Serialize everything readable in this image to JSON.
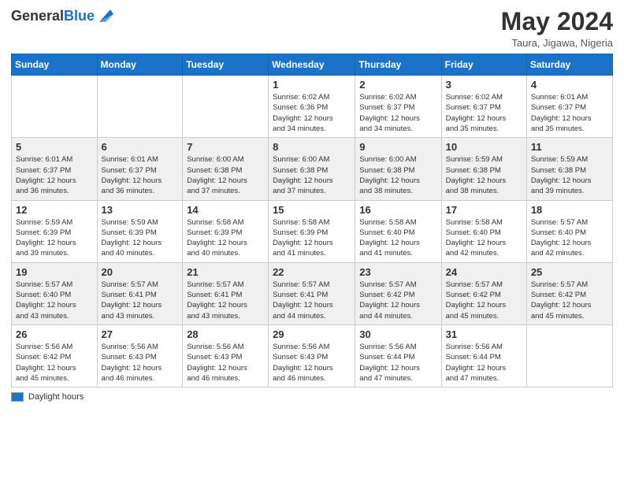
{
  "header": {
    "logo_general": "General",
    "logo_blue": "Blue",
    "month_title": "May 2024",
    "location": "Taura, Jigawa, Nigeria"
  },
  "days_of_week": [
    "Sunday",
    "Monday",
    "Tuesday",
    "Wednesday",
    "Thursday",
    "Friday",
    "Saturday"
  ],
  "weeks": [
    [
      {
        "day": "",
        "info": ""
      },
      {
        "day": "",
        "info": ""
      },
      {
        "day": "",
        "info": ""
      },
      {
        "day": "1",
        "info": "Sunrise: 6:02 AM\nSunset: 6:36 PM\nDaylight: 12 hours\nand 34 minutes."
      },
      {
        "day": "2",
        "info": "Sunrise: 6:02 AM\nSunset: 6:37 PM\nDaylight: 12 hours\nand 34 minutes."
      },
      {
        "day": "3",
        "info": "Sunrise: 6:02 AM\nSunset: 6:37 PM\nDaylight: 12 hours\nand 35 minutes."
      },
      {
        "day": "4",
        "info": "Sunrise: 6:01 AM\nSunset: 6:37 PM\nDaylight: 12 hours\nand 35 minutes."
      }
    ],
    [
      {
        "day": "5",
        "info": "Sunrise: 6:01 AM\nSunset: 6:37 PM\nDaylight: 12 hours\nand 36 minutes."
      },
      {
        "day": "6",
        "info": "Sunrise: 6:01 AM\nSunset: 6:37 PM\nDaylight: 12 hours\nand 36 minutes."
      },
      {
        "day": "7",
        "info": "Sunrise: 6:00 AM\nSunset: 6:38 PM\nDaylight: 12 hours\nand 37 minutes."
      },
      {
        "day": "8",
        "info": "Sunrise: 6:00 AM\nSunset: 6:38 PM\nDaylight: 12 hours\nand 37 minutes."
      },
      {
        "day": "9",
        "info": "Sunrise: 6:00 AM\nSunset: 6:38 PM\nDaylight: 12 hours\nand 38 minutes."
      },
      {
        "day": "10",
        "info": "Sunrise: 5:59 AM\nSunset: 6:38 PM\nDaylight: 12 hours\nand 38 minutes."
      },
      {
        "day": "11",
        "info": "Sunrise: 5:59 AM\nSunset: 6:38 PM\nDaylight: 12 hours\nand 39 minutes."
      }
    ],
    [
      {
        "day": "12",
        "info": "Sunrise: 5:59 AM\nSunset: 6:39 PM\nDaylight: 12 hours\nand 39 minutes."
      },
      {
        "day": "13",
        "info": "Sunrise: 5:59 AM\nSunset: 6:39 PM\nDaylight: 12 hours\nand 40 minutes."
      },
      {
        "day": "14",
        "info": "Sunrise: 5:58 AM\nSunset: 6:39 PM\nDaylight: 12 hours\nand 40 minutes."
      },
      {
        "day": "15",
        "info": "Sunrise: 5:58 AM\nSunset: 6:39 PM\nDaylight: 12 hours\nand 41 minutes."
      },
      {
        "day": "16",
        "info": "Sunrise: 5:58 AM\nSunset: 6:40 PM\nDaylight: 12 hours\nand 41 minutes."
      },
      {
        "day": "17",
        "info": "Sunrise: 5:58 AM\nSunset: 6:40 PM\nDaylight: 12 hours\nand 42 minutes."
      },
      {
        "day": "18",
        "info": "Sunrise: 5:57 AM\nSunset: 6:40 PM\nDaylight: 12 hours\nand 42 minutes."
      }
    ],
    [
      {
        "day": "19",
        "info": "Sunrise: 5:57 AM\nSunset: 6:40 PM\nDaylight: 12 hours\nand 43 minutes."
      },
      {
        "day": "20",
        "info": "Sunrise: 5:57 AM\nSunset: 6:41 PM\nDaylight: 12 hours\nand 43 minutes."
      },
      {
        "day": "21",
        "info": "Sunrise: 5:57 AM\nSunset: 6:41 PM\nDaylight: 12 hours\nand 43 minutes."
      },
      {
        "day": "22",
        "info": "Sunrise: 5:57 AM\nSunset: 6:41 PM\nDaylight: 12 hours\nand 44 minutes."
      },
      {
        "day": "23",
        "info": "Sunrise: 5:57 AM\nSunset: 6:42 PM\nDaylight: 12 hours\nand 44 minutes."
      },
      {
        "day": "24",
        "info": "Sunrise: 5:57 AM\nSunset: 6:42 PM\nDaylight: 12 hours\nand 45 minutes."
      },
      {
        "day": "25",
        "info": "Sunrise: 5:57 AM\nSunset: 6:42 PM\nDaylight: 12 hours\nand 45 minutes."
      }
    ],
    [
      {
        "day": "26",
        "info": "Sunrise: 5:56 AM\nSunset: 6:42 PM\nDaylight: 12 hours\nand 45 minutes."
      },
      {
        "day": "27",
        "info": "Sunrise: 5:56 AM\nSunset: 6:43 PM\nDaylight: 12 hours\nand 46 minutes."
      },
      {
        "day": "28",
        "info": "Sunrise: 5:56 AM\nSunset: 6:43 PM\nDaylight: 12 hours\nand 46 minutes."
      },
      {
        "day": "29",
        "info": "Sunrise: 5:56 AM\nSunset: 6:43 PM\nDaylight: 12 hours\nand 46 minutes."
      },
      {
        "day": "30",
        "info": "Sunrise: 5:56 AM\nSunset: 6:44 PM\nDaylight: 12 hours\nand 47 minutes."
      },
      {
        "day": "31",
        "info": "Sunrise: 5:56 AM\nSunset: 6:44 PM\nDaylight: 12 hours\nand 47 minutes."
      },
      {
        "day": "",
        "info": ""
      }
    ]
  ],
  "legend": {
    "daylight_hours": "Daylight hours"
  }
}
